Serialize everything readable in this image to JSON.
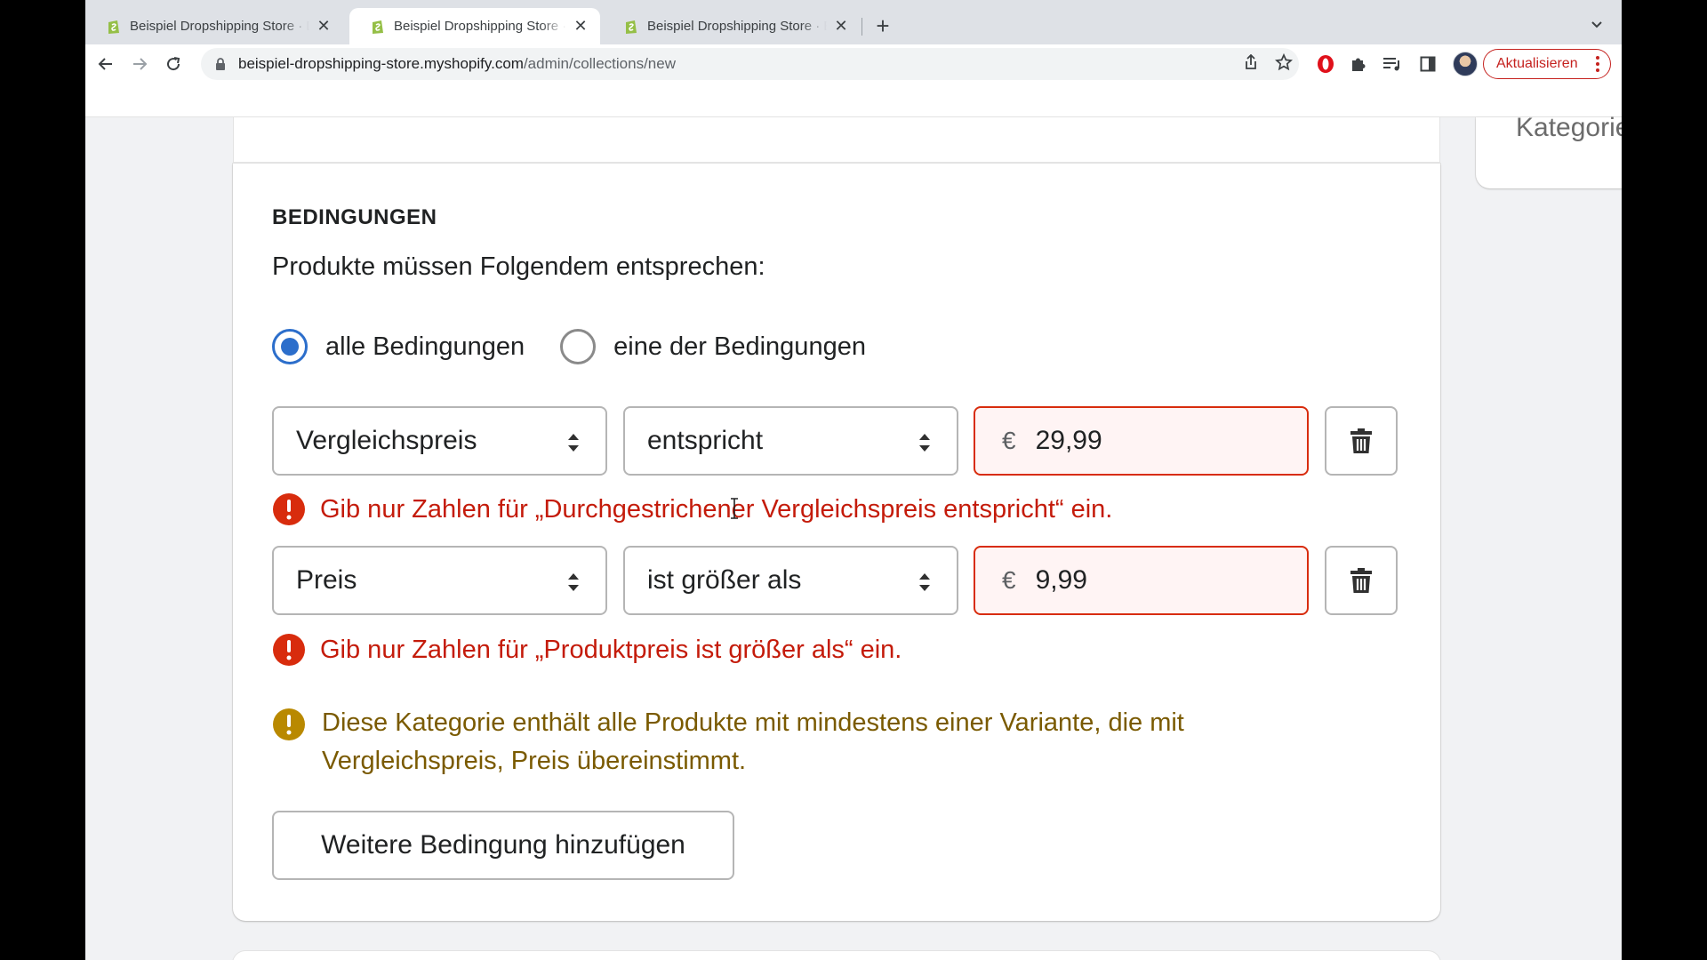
{
  "browser": {
    "tabs": [
      {
        "title": "Beispiel Dropshipping Store · Dashboard",
        "active": false
      },
      {
        "title": "Beispiel Dropshipping Store · Kategorie",
        "active": true
      },
      {
        "title": "Beispiel Dropshipping Store · Bestellungen",
        "active": false
      }
    ],
    "url_host": "beispiel-dropshipping-store.myshopify.com",
    "url_path": "/admin/collections/new",
    "update_label": "Aktualisieren",
    "accent_color": "#c5221f"
  },
  "page": {
    "side_card_label": "Kategorie",
    "section_heading": "BEDINGUNGEN",
    "subtitle": "Produkte müssen Folgendem entsprechen:",
    "match_options": [
      {
        "label": "alle Bedingungen",
        "checked": true
      },
      {
        "label": "eine der Bedingungen",
        "checked": false
      }
    ],
    "conditions": [
      {
        "field": "Vergleichspreis",
        "operator": "entspricht",
        "currency": "€",
        "value": "29,99",
        "error": "Gib nur Zahlen für „Durchgestrichener Vergleichspreis entspricht“ ein."
      },
      {
        "field": "Preis",
        "operator": "ist größer als",
        "currency": "€",
        "value": "9,99",
        "error": "Gib nur Zahlen für „Produktpreis ist größer als“ ein."
      }
    ],
    "warning": "Diese Kategorie enthält alle Produkte mit mindestens einer Variante, die mit Vergleichspreis, Preis übereinstimmt.",
    "add_condition_label": "Weitere Bedingung hinzufügen",
    "colors": {
      "primary": "#2c6ecb",
      "critical": "#d82c0d",
      "critical_text": "#c41b0a",
      "warning": "#b98900",
      "warning_text": "#7a5a00"
    }
  }
}
